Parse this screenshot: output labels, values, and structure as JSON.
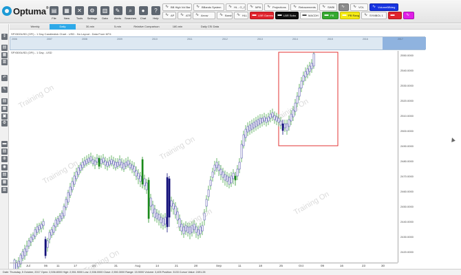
{
  "app": {
    "logo_text": "Optuma",
    "logo_reg": "®"
  },
  "toolbar": {
    "buttons": [
      {
        "name": "file",
        "label": "File",
        "icon": "▤"
      },
      {
        "name": "new",
        "label": "New",
        "icon": "▦"
      },
      {
        "name": "tools",
        "label": "Tools",
        "icon": "✕"
      },
      {
        "name": "settings",
        "label": "Settings",
        "icon": "⚙"
      },
      {
        "name": "data",
        "label": "Data",
        "icon": "▥"
      },
      {
        "name": "alerts",
        "label": "Alerts",
        "icon": "✎"
      },
      {
        "name": "searches",
        "label": "Searches",
        "icon": "⌕"
      },
      {
        "name": "chat",
        "label": "Chat",
        "icon": "●"
      },
      {
        "name": "help",
        "label": "Help",
        "icon": "?"
      }
    ],
    "indicators_row1": [
      {
        "label": "BB High Vol Bar",
        "style": "",
        "icon": "∿"
      },
      {
        "label": "BBands System",
        "style": "",
        "icon": "∿"
      },
      {
        "label": "HL - O_C",
        "style": "",
        "icon": "∿"
      },
      {
        "label": "MPA",
        "style": "",
        "icon": "∿"
      },
      {
        "label": "Projections",
        "style": "",
        "icon": "∿"
      },
      {
        "label": "Retracements",
        "style": "",
        "icon": "∿"
      },
      {
        "label": "SWBI",
        "style": "",
        "icon": "∿"
      },
      {
        "label": "",
        "style": "gray",
        "icon": "∿"
      },
      {
        "label": "VOL",
        "style": "",
        "icon": "∿"
      },
      {
        "label": "VolumeBBdeg",
        "style": "blue",
        "icon": "∿"
      }
    ],
    "indicators_row2": [
      {
        "label": "AP",
        "style": "",
        "icon": "∿"
      },
      {
        "label": "ATR",
        "style": "",
        "icon": "∿"
      },
      {
        "label": "Arrow",
        "style": "",
        "icon": "∿"
      },
      {
        "label": "BarsIsS",
        "style": "",
        "icon": "∿"
      },
      {
        "label": "HLL",
        "style": "",
        "icon": "∿"
      },
      {
        "label": "LBR Gamma",
        "style": "red",
        "icon": "▬"
      },
      {
        "label": "LBR Sobo",
        "style": "black",
        "icon": "▬"
      },
      {
        "label": "MACDH",
        "style": "",
        "icon": "▬"
      },
      {
        "label": "PB",
        "style": "green",
        "icon": "▬"
      },
      {
        "label": "PB Range",
        "style": "yellow",
        "icon": "▬"
      },
      {
        "label": "SYMBOL 1",
        "style": "",
        "icon": "∿"
      },
      {
        "label": "",
        "style": "red",
        "icon": "▬"
      },
      {
        "label": "",
        "style": "magenta",
        "icon": "∿"
      }
    ]
  },
  "periods": [
    {
      "label": "Weekly",
      "active": false
    },
    {
      "label": "Daily",
      "active": true
    },
    {
      "label": "30-min",
      "active": false
    },
    {
      "label": "5-min",
      "active": false
    },
    {
      "label": "Relative Comparison",
      "active": false
    },
    {
      "label": "180-min",
      "active": false
    },
    {
      "label": "Daily CSI Data",
      "active": false
    }
  ],
  "chart": {
    "title": "SPX500USD (OFI) - 1 Day Candlestick Chart - USD - No Layout - Data From MT4",
    "subtitle": "SPX500USD (OFI) - 1 Day - USD",
    "watermark": "Training On",
    "overview_years": [
      "2006",
      "2007",
      "2008",
      "2009",
      "2010",
      "2011",
      "2012",
      "2013",
      "2014",
      "2015",
      "2016",
      "2017"
    ]
  },
  "chart_data": {
    "type": "candlestick",
    "y_ticks": [
      2420,
      2430,
      2440,
      2450,
      2460,
      2470,
      2480,
      2490,
      2500,
      2510,
      2520,
      2530,
      2540,
      2550
    ],
    "y_labels": [
      "2420.0000",
      "2430.0000",
      "2440.0000",
      "2450.0000",
      "2460.0000",
      "2470.0000",
      "2480.0000",
      "2490.0000",
      "2500.0000",
      "2510.0000",
      "2520.0000",
      "2530.0000",
      "2540.0000",
      "2550.0000"
    ],
    "x_labels": [
      "Jul",
      "06",
      "11",
      "17",
      "24",
      "31",
      "Aug",
      "14",
      "21",
      "28",
      "Sep",
      "11",
      "18",
      "25",
      "Oct",
      "09",
      "16",
      "23",
      "30"
    ],
    "ylim": [
      2413,
      2553
    ]
  },
  "status": {
    "text": "Date: Thursday, 5 October, 2017 Open: 2,536.8000 High: 2,551.9000 Low: 2,536.0000 Close: 2,550.3000 Range: 15.9000 Volume: 3,405 Position: 3133 Cursor Value: 2491.28"
  }
}
